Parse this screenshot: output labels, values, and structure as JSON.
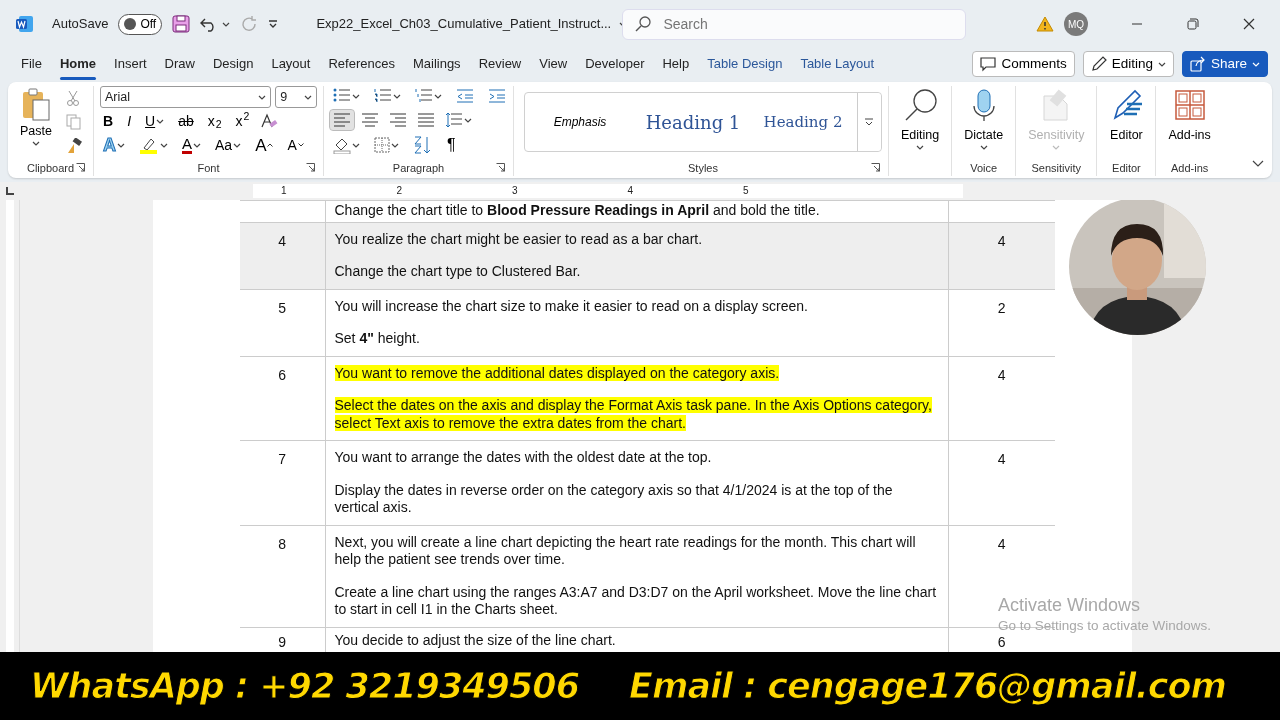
{
  "title_bar": {
    "autosave_label": "AutoSave",
    "autosave": {
      "on": false,
      "label": "Off"
    },
    "document_title": "Exp22_Excel_Ch03_Cumulative_Patient_Instruct...",
    "search": {
      "placeholder": "Search"
    },
    "account_initials": "MQ"
  },
  "menu_tabs": [
    {
      "label": "File",
      "selected": false,
      "kind": "plain"
    },
    {
      "label": "Home",
      "selected": true,
      "kind": "plain"
    },
    {
      "label": "Insert",
      "selected": false,
      "kind": "plain"
    },
    {
      "label": "Draw",
      "selected": false,
      "kind": "plain"
    },
    {
      "label": "Design",
      "selected": false,
      "kind": "plain"
    },
    {
      "label": "Layout",
      "selected": false,
      "kind": "plain"
    },
    {
      "label": "References",
      "selected": false,
      "kind": "plain"
    },
    {
      "label": "Mailings",
      "selected": false,
      "kind": "plain"
    },
    {
      "label": "Review",
      "selected": false,
      "kind": "plain"
    },
    {
      "label": "View",
      "selected": false,
      "kind": "plain"
    },
    {
      "label": "Developer",
      "selected": false,
      "kind": "plain"
    },
    {
      "label": "Help",
      "selected": false,
      "kind": "plain"
    },
    {
      "label": "Table Design",
      "selected": false,
      "kind": "contextual"
    },
    {
      "label": "Table Layout",
      "selected": false,
      "kind": "contextual"
    }
  ],
  "header_buttons": [
    {
      "label": "Comments",
      "kind": "comments"
    },
    {
      "label": "Editing",
      "kind": "editing"
    },
    {
      "label": "Share",
      "kind": "share"
    }
  ],
  "ribbon": {
    "clipboard": {
      "paste_label": "Paste",
      "group_label": "Clipboard"
    },
    "font": {
      "font_name": "Arial",
      "font_size": "9",
      "group_label": "Font",
      "row1": [
        "B",
        "I",
        "U",
        "ab",
        "x$_{2}$",
        "x$^{2}$"
      ],
      "row2": [
        {
          "glyph": "A",
          "kind": "effects"
        },
        {
          "kind": "highlight"
        },
        {
          "glyph": "A",
          "kind": "color"
        },
        {
          "glyph": "Aa",
          "kind": "case"
        },
        {
          "glyph": "A",
          "kind": "grow"
        },
        {
          "glyph": "A",
          "kind": "shrink"
        }
      ]
    },
    "paragraph": {
      "group_label": "Paragraph",
      "alignments": [
        {
          "kind": "left",
          "selected": true
        },
        {
          "kind": "center",
          "selected": false
        },
        {
          "kind": "right",
          "selected": false
        },
        {
          "kind": "justify",
          "selected": false
        }
      ],
      "pilcrow": "¶"
    },
    "styles": {
      "group_label": "Styles",
      "items": [
        {
          "label": "Emphasis",
          "kind": "emphasis"
        },
        {
          "label": "Heading 1",
          "kind": "h1"
        },
        {
          "label": "Heading 2",
          "kind": "h2"
        }
      ]
    },
    "big_buttons": [
      {
        "label": "Editing",
        "kind": "search",
        "disabled": false,
        "dropdown": true
      },
      {
        "label": "Dictate",
        "group_label": "Voice",
        "kind": "mic",
        "disabled": false,
        "dropdown": true
      },
      {
        "label": "Sensitivity",
        "group_label": "Sensitivity",
        "kind": "sensitivity",
        "disabled": true,
        "dropdown": true
      },
      {
        "label": "Editor",
        "group_label": "Editor",
        "kind": "editor",
        "disabled": false,
        "dropdown": false
      },
      {
        "label": "Add-ins",
        "group_label": "Add-ins",
        "kind": "addins",
        "disabled": false,
        "dropdown": false
      }
    ]
  },
  "ruler": {
    "numbers": [
      "1",
      "2",
      "3",
      "4",
      "5"
    ]
  },
  "table": {
    "rows": [
      {
        "shaded": false,
        "paragraphs": [
          {
            "text": "Change the chart title to **Blood Pressure Readings in April** and bold the title.",
            "highlighted": false
          }
        ]
      },
      {
        "number": "4",
        "points": "4",
        "shaded": true,
        "paragraphs": [
          {
            "text": "You realize the chart might be easier to read as a bar chart.",
            "highlighted": false
          },
          {
            "text": "Change the chart type to Clustered Bar.",
            "highlighted": false
          }
        ]
      },
      {
        "number": "5",
        "points": "2",
        "shaded": false,
        "paragraphs": [
          {
            "text": "You will increase the chart size to make it easier to read on a display screen.",
            "highlighted": false
          },
          {
            "text": "Set **4\"** height.",
            "highlighted": false
          }
        ]
      },
      {
        "number": "6",
        "points": "4",
        "shaded": false,
        "paragraphs": [
          {
            "text": "You want to remove the additional dates displayed on the category axis.",
            "highlighted": true
          },
          {
            "text": "Select the dates on the axis and display the Format Axis task pane. In the Axis Options category, select Text axis to remove the extra dates from the chart.",
            "highlighted": true
          }
        ]
      },
      {
        "number": "7",
        "points": "4",
        "shaded": false,
        "paragraphs": [
          {
            "text": "You want to arrange the dates with the oldest date at the top.",
            "highlighted": false
          },
          {
            "text": "Display the dates in reverse order on the category axis so that 4/1/2024 is at the top of the vertical axis.",
            "highlighted": false
          }
        ]
      },
      {
        "number": "8",
        "points": "4",
        "shaded": false,
        "paragraphs": [
          {
            "text": "Next, you will create a line chart depicting the heart rate readings for the month. This chart will help the patient see trends over time.",
            "highlighted": false
          },
          {
            "text": "Create a line chart using the ranges A3:A7 and D3:D7 on the April worksheet. Move the line chart to start in cell I1 in the Charts sheet.",
            "highlighted": false
          }
        ]
      },
      {
        "number": "9",
        "points": "6",
        "shaded": false,
        "paragraphs": [
          {
            "text": "You decide to adjust the size of the line chart.",
            "highlighted": false
          }
        ]
      }
    ]
  },
  "activation_notice": {
    "title": "Activate Windows",
    "subtitle": "Go to Settings to activate Windows."
  },
  "banner": {
    "phone": "WhatsApp  : +92 3219349506",
    "email": "Email  :  cengage176@gmail.com"
  }
}
